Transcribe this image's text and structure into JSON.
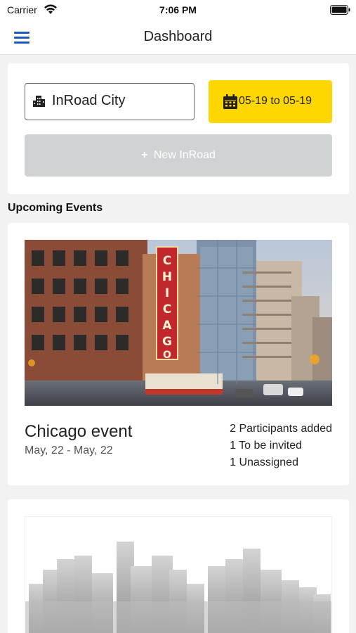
{
  "status_bar": {
    "carrier": "Carrier",
    "time": "7:06 PM"
  },
  "nav": {
    "title": "Dashboard",
    "menu_icon": "hamburger-menu-icon"
  },
  "filters": {
    "city_label": "InRoad City",
    "city_icon": "building-icon",
    "date_range": "05-19 to 05-19",
    "date_icon": "calendar-icon",
    "new_button_label": "New InRoad"
  },
  "section": {
    "heading": "Upcoming Events"
  },
  "events": [
    {
      "title": "Chicago event",
      "dates": "May, 22 - May, 22",
      "stats": [
        "2 Participants added",
        "1 To be invited",
        "1 Unassigned"
      ]
    }
  ],
  "colors": {
    "accent": "#1e5bb8",
    "date_button": "#ffd700",
    "disabled_button": "#d0d3d4"
  }
}
